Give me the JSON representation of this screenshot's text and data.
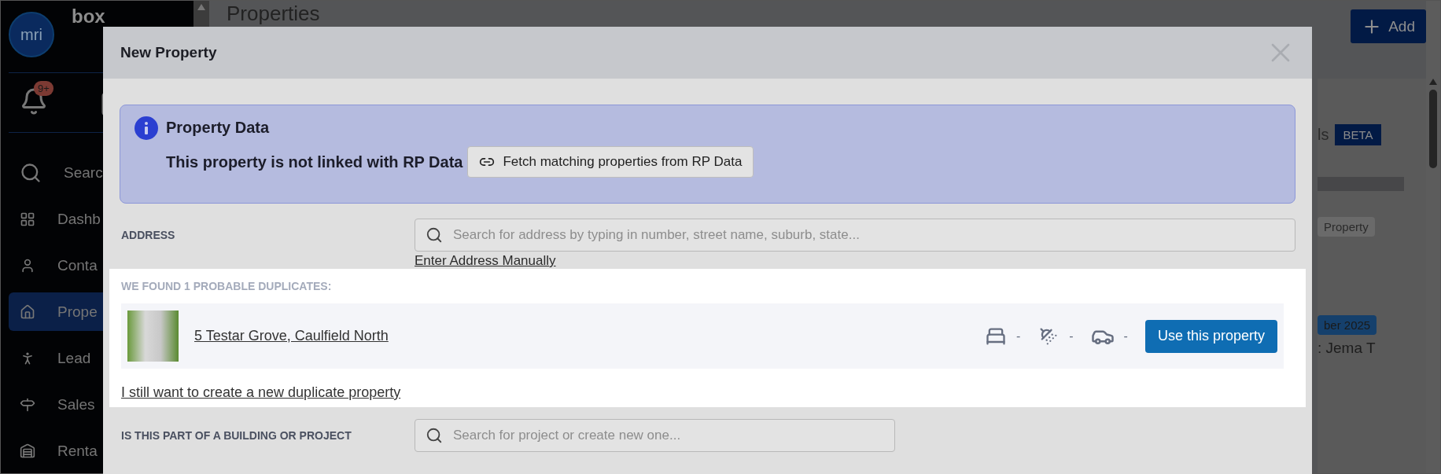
{
  "sidebar": {
    "logo": "mri",
    "brand": "box",
    "notification_badge": "9+",
    "items": [
      {
        "label": "Searc",
        "selected": false
      },
      {
        "label": "Dashb",
        "selected": false
      },
      {
        "label": "Conta",
        "selected": false
      },
      {
        "label": "Prope",
        "selected": true
      },
      {
        "label": "Lead",
        "selected": false
      },
      {
        "label": "Sales",
        "selected": false
      },
      {
        "label": "Renta",
        "selected": false
      }
    ]
  },
  "page": {
    "title": "Properties",
    "add_button": "Add",
    "tab_fragment": "ls",
    "beta_badge": "BETA",
    "property_badge": "Property",
    "date_badge": "ber 2025",
    "agent_fragment": ": Jema T"
  },
  "modal": {
    "title": "New Property",
    "info": {
      "title": "Property Data",
      "message": "This property is not linked with RP Data",
      "fetch_button": "Fetch matching properties from RP Data"
    },
    "address": {
      "label": "ADDRESS",
      "placeholder": "Search for address by typing in number, street name, suburb, state...",
      "manual_link": "Enter Address Manually"
    },
    "duplicates": {
      "heading": "WE FOUND 1 PROBABLE DUPLICATES:",
      "items": [
        {
          "address": "5 Testar Grove, Caulfield North",
          "bedrooms": "-",
          "bathrooms": "-",
          "car_spaces": "-",
          "button": "Use this property"
        }
      ],
      "create_link": "I still want to create a new duplicate property"
    },
    "project": {
      "label": "IS THIS PART OF A BUILDING OR PROJECT",
      "placeholder": "Search for project or create new one..."
    }
  }
}
